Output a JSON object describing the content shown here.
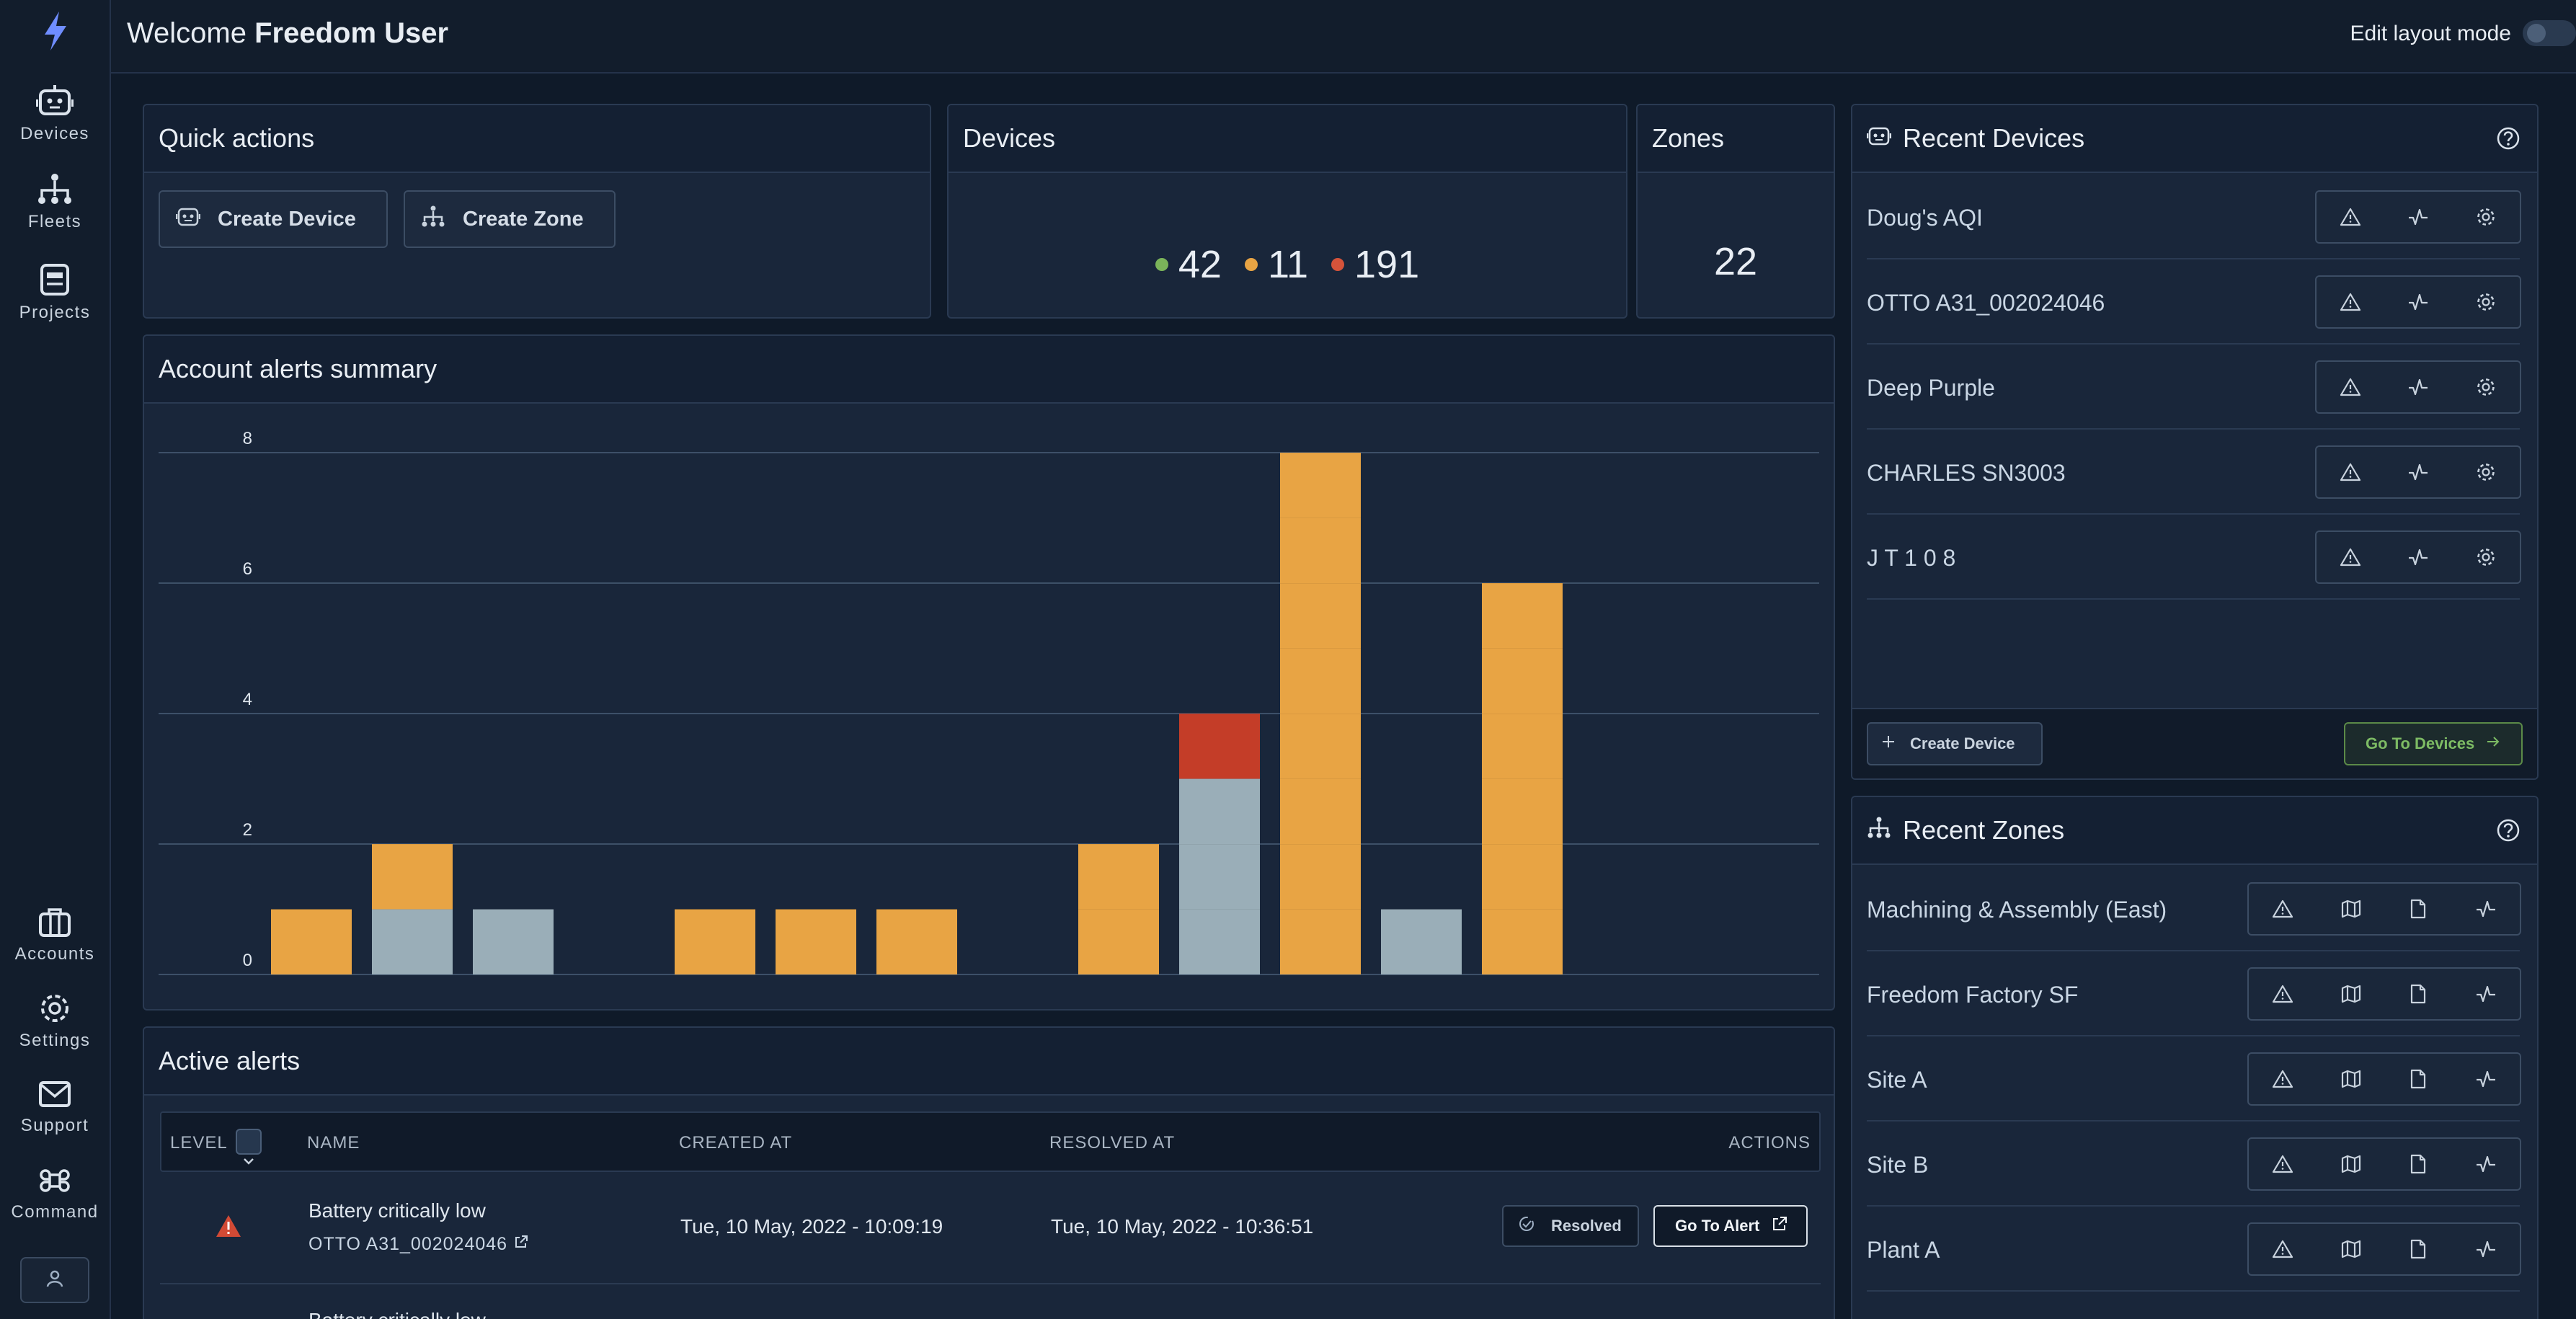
{
  "nav": {
    "top": [
      {
        "label": "Devices",
        "icon": "robot-icon"
      },
      {
        "label": "Fleets",
        "icon": "hierarchy-icon"
      },
      {
        "label": "Projects",
        "icon": "projects-icon"
      }
    ],
    "bottom": [
      {
        "label": "Accounts",
        "icon": "briefcase-icon"
      },
      {
        "label": "Settings",
        "icon": "gear-icon"
      },
      {
        "label": "Support",
        "icon": "mail-icon"
      },
      {
        "label": "Command",
        "icon": "command-icon"
      }
    ]
  },
  "header": {
    "welcome_prefix": "Welcome",
    "user_name": "Freedom User",
    "edit_layout_label": "Edit layout mode"
  },
  "quick_actions": {
    "title": "Quick actions",
    "create_device": "Create Device",
    "create_zone": "Create Zone"
  },
  "devices_card": {
    "title": "Devices",
    "online": "42",
    "warning": "11",
    "offline": "191"
  },
  "zones_card": {
    "title": "Zones",
    "count": "22"
  },
  "colors": {
    "online": "#7bb45a",
    "warning": "#e8a444",
    "critical": "#c43d28",
    "resolved_grey": "#9aaeb8",
    "accent_green": "#7dbb64"
  },
  "alerts_summary": {
    "title": "Account alerts summary"
  },
  "chart_data": {
    "type": "bar",
    "stacked": true,
    "title": "Account alerts summary",
    "ylim": [
      0,
      8
    ],
    "yticks": [
      "0",
      "2",
      "4",
      "6",
      "8"
    ],
    "grid": true,
    "num_slots": 16,
    "series": [
      {
        "color": "#9aaeb8",
        "values": [
          0,
          1,
          1,
          0,
          0,
          0,
          0,
          0,
          0,
          3,
          0,
          1,
          0,
          0,
          0,
          0
        ]
      },
      {
        "color": "#e8a444",
        "values": [
          1,
          1,
          0,
          0,
          1,
          1,
          1,
          0,
          2,
          0,
          8,
          0,
          6,
          0,
          0,
          0
        ]
      },
      {
        "color": "#c43d28",
        "values": [
          0,
          0,
          0,
          0,
          0,
          0,
          0,
          0,
          0,
          1,
          0,
          0,
          0,
          0,
          0,
          0
        ]
      }
    ]
  },
  "active_alerts": {
    "title": "Active alerts",
    "columns": {
      "level": "LEVEL",
      "name": "NAME",
      "created_at": "CREATED AT",
      "resolved_at": "RESOLVED AT",
      "actions": "ACTIONS"
    },
    "rows": [
      {
        "name": "Battery critically low",
        "device": "OTTO A31_002024046",
        "created_at": "Tue, 10 May, 2022 - 10:09:19",
        "resolved_at": "Tue, 10 May, 2022 - 10:36:51",
        "resolved_label": "Resolved",
        "goto_label": "Go To Alert"
      },
      {
        "name": "Battery critically low"
      }
    ]
  },
  "recent_devices": {
    "title": "Recent Devices",
    "items": [
      "Doug's AQI",
      "OTTO A31_002024046",
      "Deep Purple",
      "CHARLES SN3003",
      "J T 1 0 8"
    ],
    "create_label": "Create Device",
    "goto_label": "Go To Devices"
  },
  "recent_zones": {
    "title": "Recent Zones",
    "items": [
      "Machining & Assembly (East)",
      "Freedom Factory SF",
      "Site A",
      "Site B",
      "Plant A"
    ]
  }
}
